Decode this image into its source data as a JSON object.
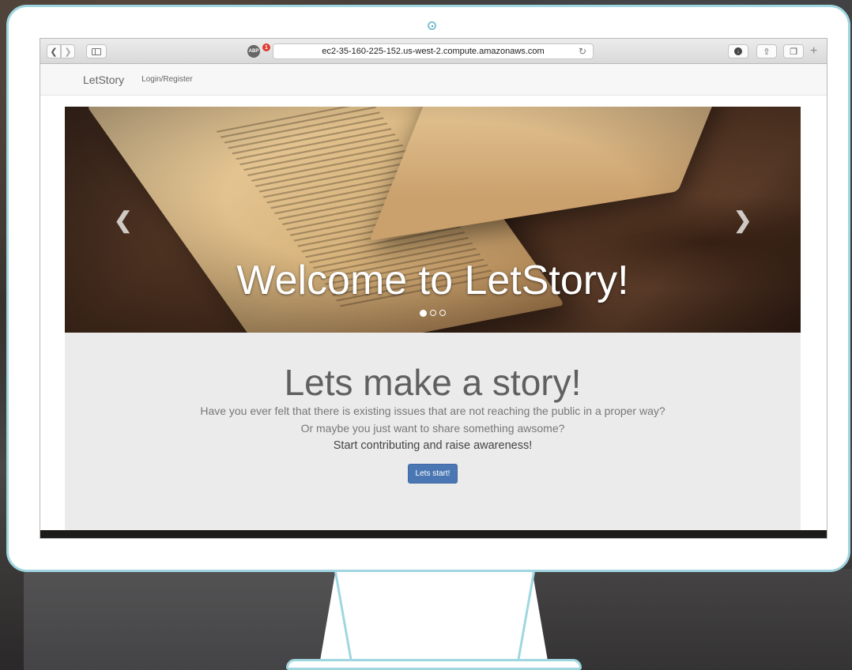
{
  "browser": {
    "url": "ec2-35-160-225-152.us-west-2.compute.amazonaws.com",
    "adblock_label": "ABP",
    "adblock_count": "1",
    "icons": {
      "back": "chevron-left-icon",
      "forward": "chevron-right-icon",
      "sidebar": "sidebar-icon",
      "reload": "reload-icon",
      "download": "download-icon",
      "share": "share-icon",
      "tabs": "tabs-icon",
      "new_tab": "plus-icon"
    }
  },
  "site": {
    "brand": "LetStory",
    "nav": [
      "Login/Register"
    ]
  },
  "carousel": {
    "caption": "Welcome to LetStory!",
    "slide_count": 3,
    "active_index": 0
  },
  "jumbotron": {
    "title": "Lets make a story!",
    "line1": "Have you ever felt that there is existing issues that are not reaching the public in a proper way?",
    "line2": "Or maybe you just want to share something awsome?",
    "line3": "Start contributing and raise awareness!",
    "button_label": "Lets start!"
  },
  "colors": {
    "monitor_outline": "#9fd6e0",
    "primary_button": "#4a77b4",
    "jumbotron_bg": "#ebebeb",
    "adblock_badge": "#e03a2f"
  }
}
